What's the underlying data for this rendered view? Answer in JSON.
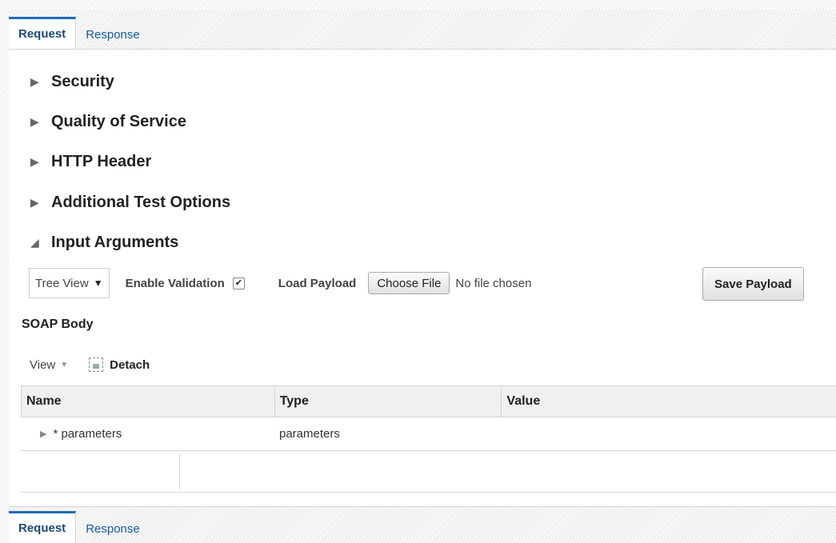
{
  "tabs": {
    "request": "Request",
    "response": "Response"
  },
  "sections": {
    "security": "Security",
    "qos": "Quality of Service",
    "http_header": "HTTP Header",
    "additional": "Additional Test Options",
    "input_arguments": "Input Arguments"
  },
  "toolbar": {
    "view_select": "Tree View",
    "enable_validation_label": "Enable Validation",
    "enable_validation_checked": true,
    "load_payload_label": "Load Payload",
    "choose_file_button": "Choose File",
    "file_status": "No file chosen",
    "save_payload_button": "Save Payload"
  },
  "soap": {
    "title": "SOAP Body",
    "view_menu": "View",
    "detach": "Detach"
  },
  "table": {
    "headers": [
      "Name",
      "Type",
      "Value"
    ],
    "rows": [
      {
        "name": "* parameters",
        "type": "parameters",
        "value": ""
      }
    ]
  },
  "icons": {
    "collapsed": "triangle-right-icon",
    "expanded": "triangle-down-icon",
    "check": "check-icon",
    "detach": "detach-icon"
  }
}
